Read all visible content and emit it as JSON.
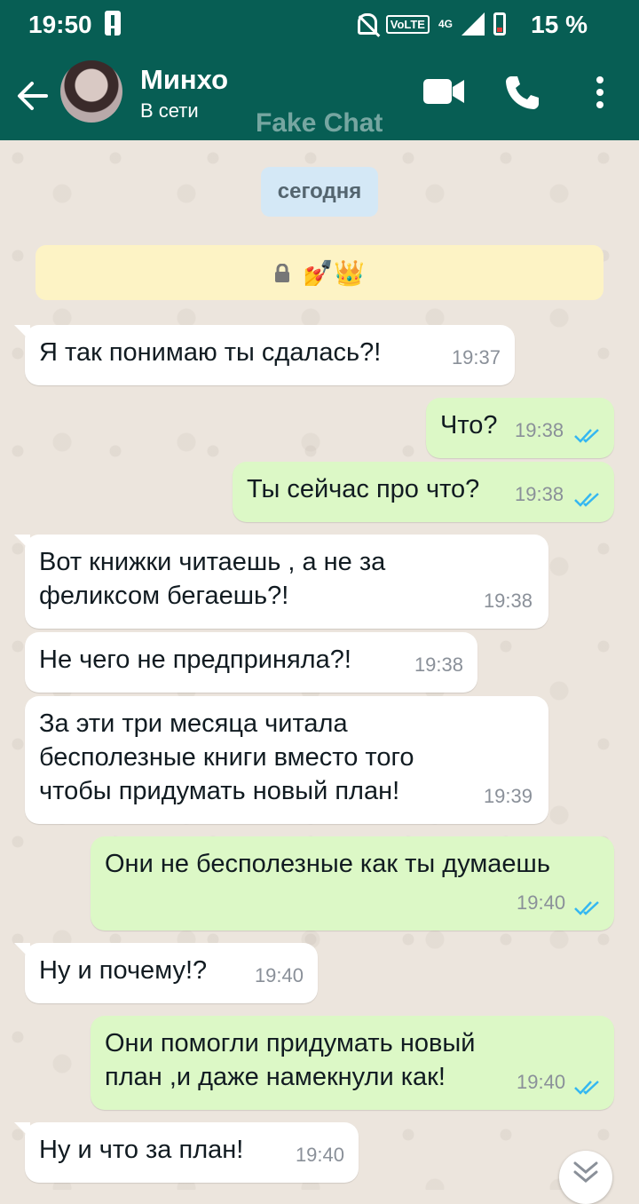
{
  "status_bar": {
    "time": "19:50",
    "network": "VoLTE",
    "network_gen": "4G",
    "battery_label": "15 %",
    "icons": [
      "alert-icon",
      "mute-bell-icon",
      "volte-icon",
      "signal-icon",
      "battery-icon"
    ]
  },
  "header": {
    "back_icon": "arrow-left-icon",
    "contact_name": "Минхо",
    "presence": "В сети",
    "watermark": "Fake Chat",
    "icons": [
      "video-call-icon",
      "phone-call-icon",
      "more-vert-icon"
    ],
    "accent_color": "#075e54"
  },
  "chat": {
    "date_label": "сегодня",
    "notice_emojis": "💅👑",
    "notice_icon": "lock-icon",
    "messages": [
      {
        "direction": "in",
        "text": "Я так понимаю ты сдалась?!",
        "time": "19:37"
      },
      {
        "direction": "out",
        "text": "Что?",
        "time": "19:38",
        "status": "read"
      },
      {
        "direction": "out",
        "text": "Ты сейчас про что?",
        "time": "19:38",
        "status": "read"
      },
      {
        "direction": "in",
        "text": "Вот книжки читаешь , а не за\nфеликсом бегаешь?!",
        "time": "19:38"
      },
      {
        "direction": "in",
        "text": "Не чего не предприняла?!",
        "time": "19:38"
      },
      {
        "direction": "in",
        "text": "За эти три месяца читала\nбесполезные книги вместо того\nчтобы придумать новый план!",
        "time": "19:39"
      },
      {
        "direction": "out",
        "text": "Они не бесполезные как ты думаешь",
        "time": "19:40",
        "status": "read"
      },
      {
        "direction": "in",
        "text": "Ну и почему!?",
        "time": "19:40"
      },
      {
        "direction": "out",
        "text": "Они помогли придумать новый\nплан ,и даже намекнули как!",
        "time": "19:40",
        "status": "read"
      },
      {
        "direction": "in",
        "text": "Ну и что за план!",
        "time": "19:40"
      }
    ],
    "incoming_color": "#ffffff",
    "outgoing_color": "#dcf8c6",
    "read_tick_color": "#34b7f1",
    "scroll_down_icon": "chevron-double-down-icon"
  }
}
